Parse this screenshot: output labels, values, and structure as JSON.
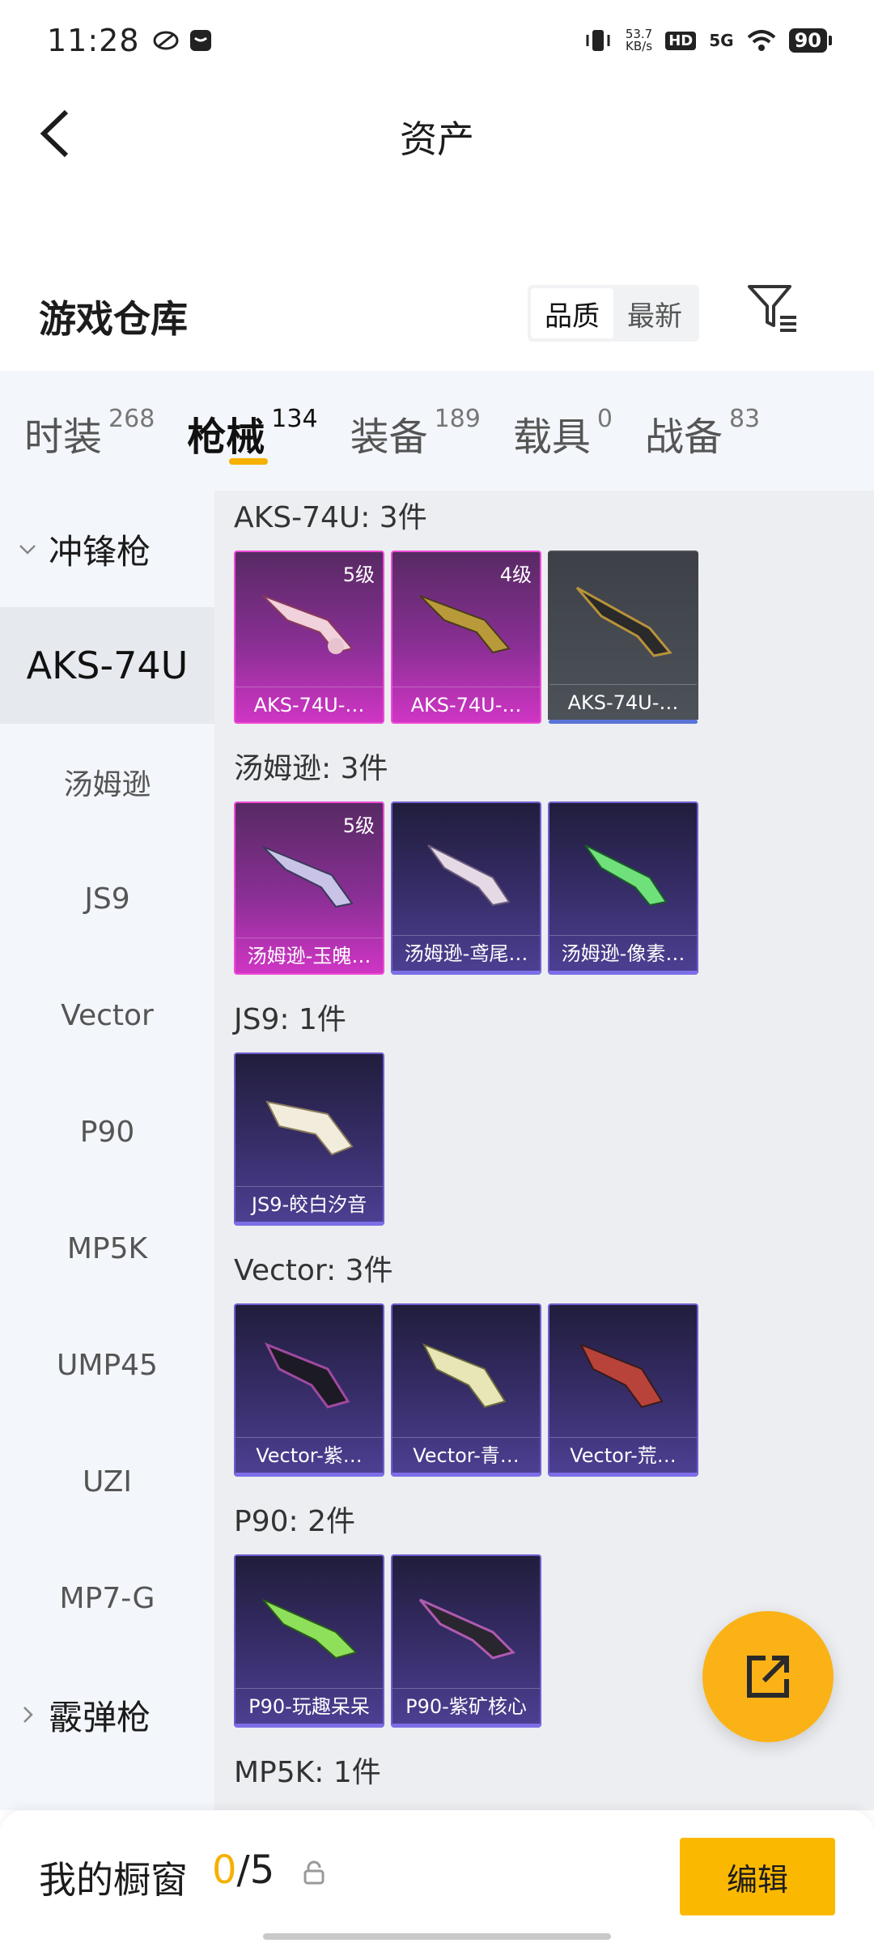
{
  "status_bar": {
    "time": "11:28",
    "speed_top": "53.7",
    "speed_unit": "KB/s",
    "hd": "HD",
    "network": "5G",
    "battery": "90"
  },
  "header": {
    "title": "资产"
  },
  "section": {
    "title": "游戏仓库",
    "sort_quality": "品质",
    "sort_newest": "最新"
  },
  "tabs": [
    {
      "label": "时装",
      "count": "268"
    },
    {
      "label": "枪械",
      "count": "134"
    },
    {
      "label": "装备",
      "count": "189"
    },
    {
      "label": "载具",
      "count": "0"
    },
    {
      "label": "战备",
      "count": "83"
    }
  ],
  "sidebar": {
    "group_1": "冲锋枪",
    "items": [
      "AKS-74U",
      "汤姆逊",
      "JS9",
      "Vector",
      "P90",
      "MP5K",
      "UMP45",
      "UZI",
      "MP7-G"
    ],
    "group_2": "霰弹枪"
  },
  "categories": [
    {
      "title": "AKS-74U: 3件",
      "cards": [
        {
          "name": "AKS-74U-…",
          "level": "5级",
          "rarity": "pink"
        },
        {
          "name": "AKS-74U-…",
          "level": "4级",
          "rarity": "pink"
        },
        {
          "name": "AKS-74U-…",
          "level": "",
          "rarity": "gray"
        }
      ]
    },
    {
      "title": "汤姆逊: 3件",
      "cards": [
        {
          "name": "汤姆逊-玉魄…",
          "level": "5级",
          "rarity": "pink"
        },
        {
          "name": "汤姆逊-鸢尾…",
          "level": "",
          "rarity": "blue"
        },
        {
          "name": "汤姆逊-像素…",
          "level": "",
          "rarity": "blue"
        }
      ]
    },
    {
      "title": "JS9: 1件",
      "cards": [
        {
          "name": "JS9-皎白汐音",
          "level": "",
          "rarity": "blue"
        }
      ]
    },
    {
      "title": "Vector: 3件",
      "cards": [
        {
          "name": "Vector-紫…",
          "level": "",
          "rarity": "blue"
        },
        {
          "name": "Vector-青…",
          "level": "",
          "rarity": "blue"
        },
        {
          "name": "Vector-荒…",
          "level": "",
          "rarity": "blue"
        }
      ]
    },
    {
      "title": "P90: 2件",
      "cards": [
        {
          "name": "P90-玩趣呆呆",
          "level": "",
          "rarity": "blue"
        },
        {
          "name": "P90-紫矿核心",
          "level": "",
          "rarity": "blue"
        }
      ]
    },
    {
      "title": "MP5K: 1件",
      "cards": []
    }
  ],
  "bottom_bar": {
    "title": "我的橱窗",
    "current": "0",
    "total": "/5",
    "edit_label": "编辑"
  },
  "colors": {
    "accent": "#f5b000",
    "rarity_pink": "#f04bd6",
    "rarity_blue": "#6f5fd0",
    "rarity_gray": "#5a73d8"
  }
}
